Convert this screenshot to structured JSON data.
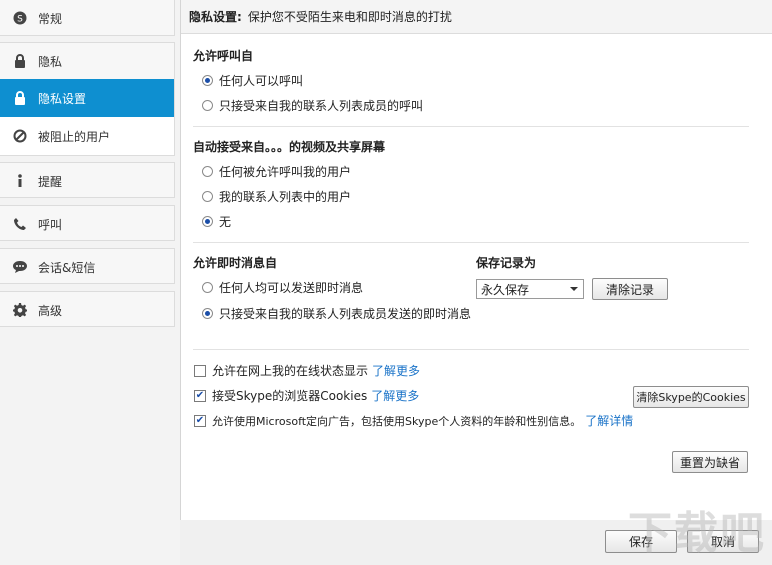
{
  "sidebar": {
    "items": [
      {
        "label": "常规"
      },
      {
        "label": "隐私"
      },
      {
        "label": "隐私设置"
      },
      {
        "label": "被阻止的用户"
      },
      {
        "label": "提醒"
      },
      {
        "label": "呼叫"
      },
      {
        "label": "会话&短信"
      },
      {
        "label": "高级"
      }
    ]
  },
  "header": {
    "title": "隐私设置:",
    "subtitle": "保护您不受陌生来电和即时消息的打扰"
  },
  "calls": {
    "title": "允许呼叫自",
    "options": [
      "任何人可以呼叫",
      "只接受来自我的联系人列表成员的呼叫"
    ]
  },
  "video": {
    "title": "自动接受来自。。。的视频及共享屏幕",
    "options": [
      "任何被允许呼叫我的用户",
      "我的联系人列表中的用户",
      "无"
    ]
  },
  "im": {
    "title": "允许即时消息自",
    "options": [
      "任何人均可以发送即时消息",
      "只接受来自我的联系人列表成员发送的即时消息"
    ]
  },
  "history": {
    "title": "保存记录为",
    "selected": "永久保存",
    "clear_button": "清除记录"
  },
  "checks": [
    {
      "label": "允许在网上我的在线状态显示",
      "link": "了解更多",
      "checked": false
    },
    {
      "label": "接受Skype的浏览器Cookies",
      "link": "了解更多",
      "checked": true
    },
    {
      "label": "允许使用Microsoft定向广告，包括使用Skype个人资料的年龄和性别信息。",
      "link": "了解详情",
      "checked": true
    }
  ],
  "buttons": {
    "clear_cookies": "清除Skype的Cookies",
    "reset": "重置为缺省",
    "save": "保存",
    "cancel": "取消"
  },
  "watermark": "下载吧"
}
